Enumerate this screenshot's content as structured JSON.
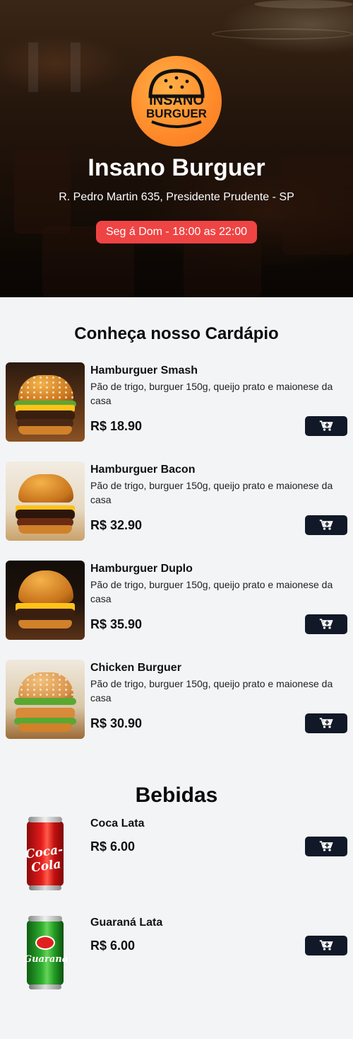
{
  "hero": {
    "restaurant_name": "Insano Burguer",
    "address": "R. Pedro Martin 635, Presidente Prudente - SP",
    "hours": "Seg á Dom - 18:00 as 22:00",
    "logo_text_line1": "INSANO",
    "logo_text_line2": "BURGUER"
  },
  "menu": {
    "title": "Conheça nosso Cardápio",
    "items": [
      {
        "name": "Hamburguer Smash",
        "description": "Pão de trigo, burguer 150g, queijo prato e maionese da casa",
        "price": "R$ 18.90"
      },
      {
        "name": "Hamburguer Bacon",
        "description": "Pão de trigo, burguer 150g, queijo prato e maionese da casa",
        "price": "R$ 32.90"
      },
      {
        "name": "Hamburguer Duplo",
        "description": "Pão de trigo, burguer 150g, queijo prato e maionese da casa",
        "price": "R$ 35.90"
      },
      {
        "name": "Chicken Burguer",
        "description": "Pão de trigo, burguer 150g, queijo prato e maionese da casa",
        "price": "R$ 30.90"
      }
    ]
  },
  "drinks": {
    "title": "Bebidas",
    "items": [
      {
        "name": "Coca Lata",
        "price": "R$ 6.00",
        "can_label": "Coca-Cola"
      },
      {
        "name": "Guaraná Lata",
        "price": "R$ 6.00",
        "can_label": "Guaraná"
      }
    ]
  },
  "icons": {
    "cart": "add-to-cart-icon"
  },
  "colors": {
    "hours_badge": "#ef4444",
    "cart_button": "#111827",
    "logo": "#ff8a2a"
  }
}
